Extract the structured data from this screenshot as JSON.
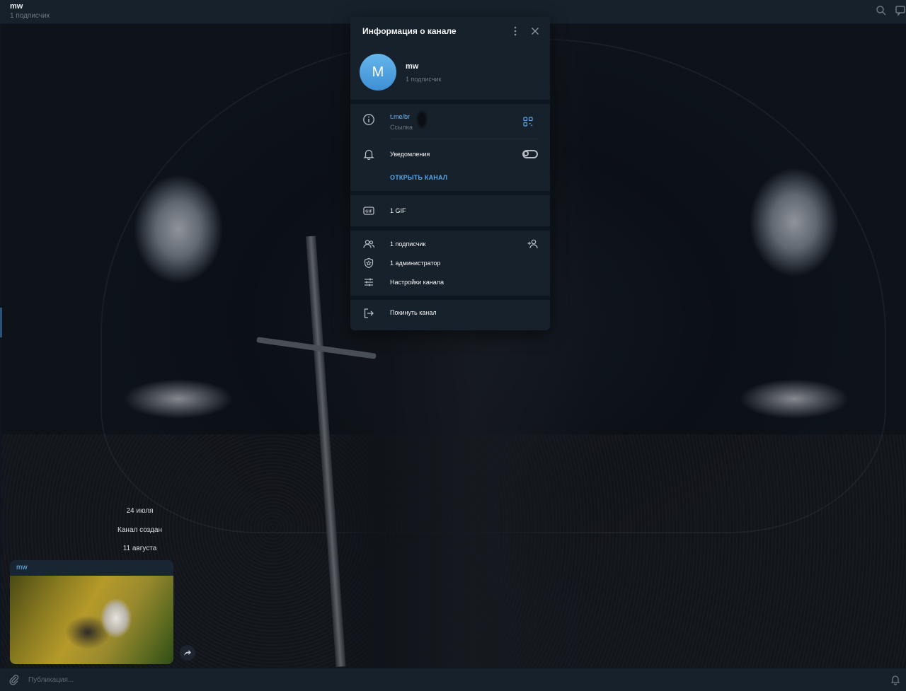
{
  "header": {
    "title": "mw",
    "subtitle": "1 подписчик"
  },
  "chat": {
    "service_messages": [
      "24 июля",
      "Канал создан",
      "11 августа"
    ],
    "post": {
      "author": "mw"
    }
  },
  "composer": {
    "placeholder": "Публикация..."
  },
  "modal": {
    "title": "Информация о канале",
    "profile": {
      "avatar_letter": "M",
      "avatar_color": "#4a9fe3",
      "name": "mw",
      "subscribers": "1 подписчик"
    },
    "link": {
      "url": "t.me/br",
      "label": "Ссылка"
    },
    "notifications": {
      "label": "Уведомления",
      "enabled": false
    },
    "open_channel": "ОТКРЫТЬ КАНАЛ",
    "media": {
      "gif_count": "1 GIF"
    },
    "members": {
      "subscribers": "1 подписчик",
      "admins": "1 администратор",
      "settings": "Настройки канала"
    },
    "leave": "Покинуть канал"
  },
  "colors": {
    "panel": "#17212b",
    "background": "#0e1621",
    "accent": "#5aa6e6",
    "link": "#71baf2",
    "muted": "#6d7883"
  }
}
